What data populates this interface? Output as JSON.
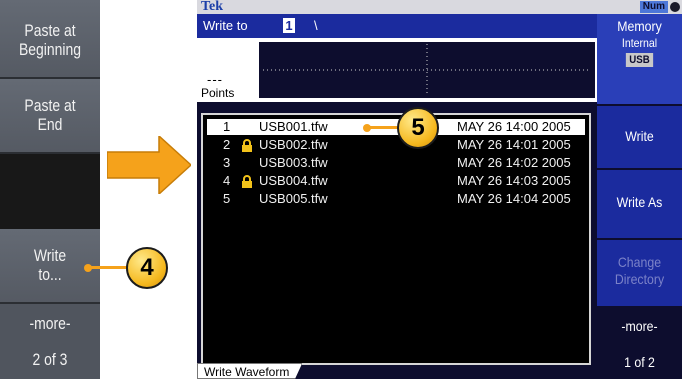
{
  "left_softkeys": [
    {
      "line1": "Paste at",
      "line2": "Beginning"
    },
    {
      "line1": "Paste at",
      "line2": "End"
    },
    {
      "line1": "",
      "line2": ""
    },
    {
      "line1": "Write",
      "line2": "to..."
    },
    {
      "line1": "-more-",
      "line2": ""
    },
    {
      "line1": "2 of 3",
      "line2": ""
    }
  ],
  "header": {
    "logo": "Tek",
    "num_badge": "Num"
  },
  "write_to": {
    "label": "Write to",
    "cursor_char": "1",
    "path_separator": "\\"
  },
  "preview": {
    "dashes": "---",
    "points_label": "Points"
  },
  "files": [
    {
      "index": "1",
      "locked": false,
      "name": "USB001.tfw",
      "date": "MAY 26 14:00 2005",
      "selected": true
    },
    {
      "index": "2",
      "locked": true,
      "name": "USB002.tfw",
      "date": "MAY 26 14:01 2005",
      "selected": false
    },
    {
      "index": "3",
      "locked": false,
      "name": "USB003.tfw",
      "date": "MAY 26 14:02 2005",
      "selected": false
    },
    {
      "index": "4",
      "locked": true,
      "name": "USB004.tfw",
      "date": "MAY 26 14:03 2005",
      "selected": false
    },
    {
      "index": "5",
      "locked": false,
      "name": "USB005.tfw",
      "date": "MAY 26 14:04 2005",
      "selected": false
    }
  ],
  "tab_label": "Write Waveform",
  "right_softkeys": {
    "memory_title": "Memory",
    "memory_internal": "Internal",
    "memory_usb": "USB",
    "write": "Write",
    "write_as": "Write As",
    "change_dir_line1": "Change",
    "change_dir_line2": "Directory",
    "more": "-more-",
    "page": "1 of 2"
  },
  "callouts": {
    "step4": "4",
    "step5": "5"
  },
  "colors": {
    "screen_bg": "#0d0d2e",
    "softkey_blue": "#1b2b9e",
    "callout_orange": "#f5a21b",
    "lock_yellow": "#f2c21a"
  }
}
